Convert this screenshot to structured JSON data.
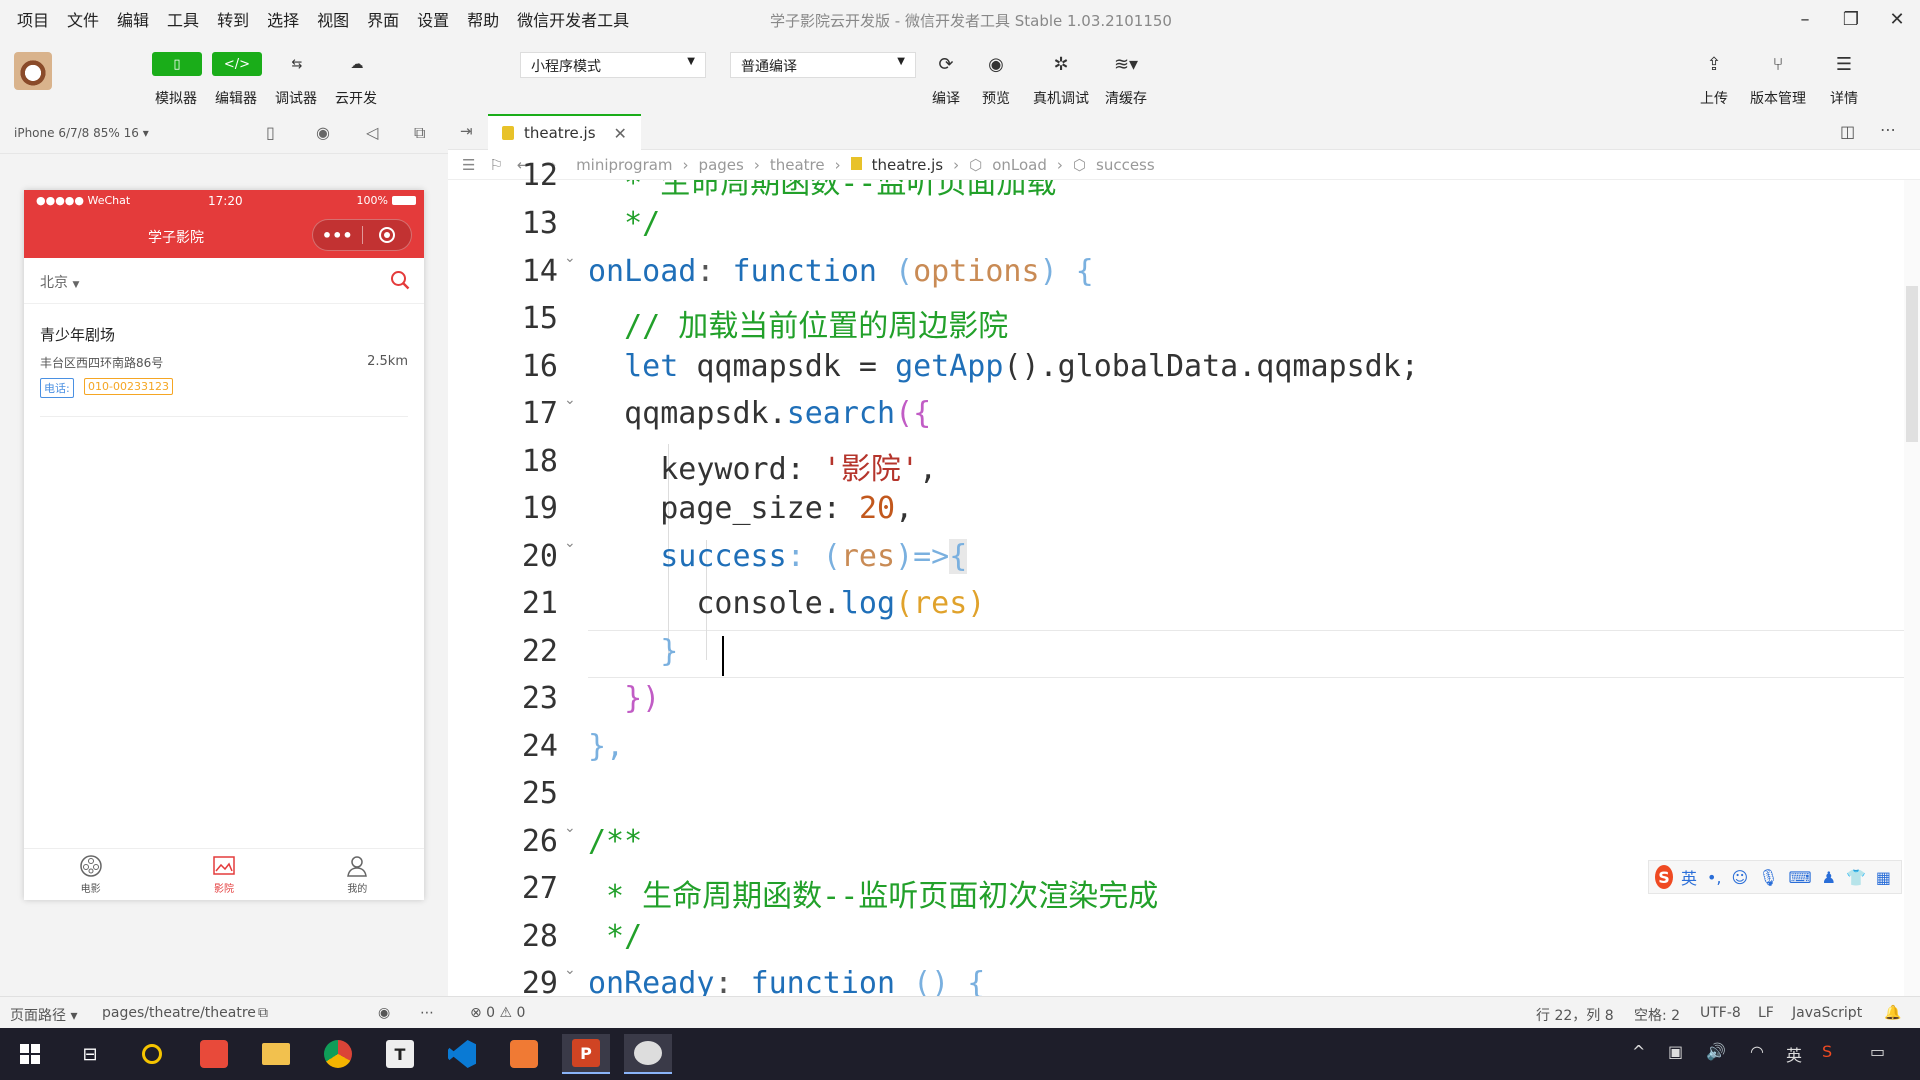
{
  "app": {
    "menu": [
      "项目",
      "文件",
      "编辑",
      "工具",
      "转到",
      "选择",
      "视图",
      "界面",
      "设置",
      "帮助",
      "微信开发者工具"
    ],
    "title": "学子影院云开发版 - 微信开发者工具 Stable 1.03.2101150"
  },
  "toolbar": {
    "simulator": "模拟器",
    "editor": "编辑器",
    "debugger": "调试器",
    "cloud": "云开发",
    "mode": "小程序模式",
    "compile_mode": "普通编译",
    "compile": "编译",
    "preview": "预览",
    "remote_debug": "真机调试",
    "clear_cache": "清缓存",
    "upload": "上传",
    "version": "版本管理",
    "details": "详情"
  },
  "simulator": {
    "device": "iPhone 6/7/8 85% 16 ▾",
    "status_signal": "●●●●● WeChat",
    "status_time": "17:20",
    "status_battery": "100%",
    "nav_title": "学子影院",
    "city": "北京",
    "theatre": {
      "name": "青少年剧场",
      "address": "丰台区西四环南路86号",
      "distance": "2.5km",
      "phone_label": "电话:",
      "phone": "010-00233123"
    },
    "tabs": [
      "电影",
      "影院",
      "我的"
    ],
    "colors": {
      "primary": "#e43b3b",
      "accent_orange": "#f5a623"
    }
  },
  "editor": {
    "tab": "theatre.js",
    "breadcrumb": [
      "miniprogram",
      "pages",
      "theatre",
      "theatre.js",
      "onLoad",
      "success"
    ],
    "line_numbers": [
      "12",
      "13",
      "14",
      "15",
      "16",
      "17",
      "18",
      "19",
      "20",
      "21",
      "22",
      "23",
      "24",
      "25",
      "26",
      "27",
      "28",
      "29"
    ],
    "lines": {
      "l12": "  * 生命周期函数--监听页面加载",
      "l13": "  */",
      "l14a": "onLoad",
      "l14b": ": ",
      "l14c": "function",
      "l14d": " (",
      "l14e": "options",
      "l14f": ") {",
      "l15": "  // 加载当前位置的周边影院",
      "l16a": "  let ",
      "l16b": "qqmapsdk = ",
      "l16c": "getApp",
      "l16d": "().globalData.qqmapsdk;",
      "l17a": "  qqmapsdk.",
      "l17b": "search",
      "l17c": "({",
      "l18a": "    keyword: ",
      "l18b": "'影院'",
      "l18c": ",",
      "l19a": "    page_size: ",
      "l19b": "20",
      "l19c": ",",
      "l20a": "    success",
      "l20b": ": (",
      "l20c": "res",
      "l20d": ")=>",
      "l20e": "{",
      "l21a": "      console.",
      "l21b": "log",
      "l21c": "(res)",
      "l22": "    }",
      "l23": "  })",
      "l24": "},",
      "l26": "/**",
      "l27": " * 生命周期函数--监听页面初次渲染完成",
      "l28": " */",
      "l29a": "onReady",
      "l29b": ": ",
      "l29c": "function",
      "l29d": " () {"
    }
  },
  "statusbar": {
    "page_path_label": "页面路径 ▾",
    "page_path": "pages/theatre/theatre",
    "errors": "⊗ 0 ⚠ 0",
    "cursor_pos": "行 22，列 8",
    "spaces": "空格: 2",
    "encoding": "UTF-8",
    "eol": "LF",
    "language": "JavaScript"
  },
  "ime": {
    "lang": "英"
  },
  "taskbar": {
    "tray_lang": "英"
  }
}
